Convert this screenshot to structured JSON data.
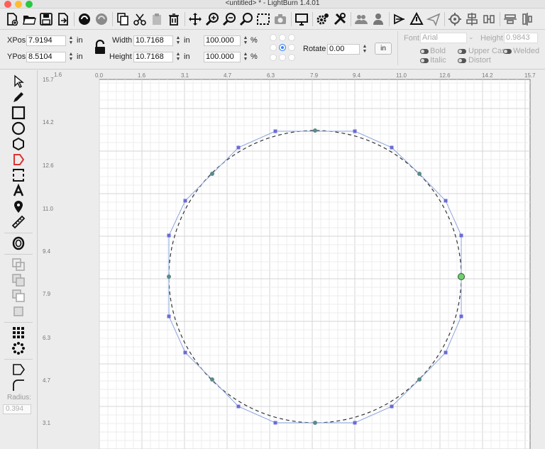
{
  "window": {
    "title": "<untitled> * - LightBurn 1.4.01"
  },
  "props": {
    "xpos_label": "XPos",
    "xpos_value": "7.9194",
    "ypos_label": "YPos",
    "ypos_value": "8.5104",
    "unit": "in",
    "width_label": "Width",
    "width_value": "10.7168",
    "height_label": "Height",
    "height_value": "10.7168",
    "scale_w": "100.000",
    "scale_h": "100.000",
    "percent": "%",
    "rotate_label": "Rotate",
    "rotate_value": "0.00",
    "in_button": "in",
    "font_label": "Font",
    "font_value": "Arial",
    "text_height_label": "Height",
    "text_height_value": "0.9843",
    "bold": "Bold",
    "italic": "Italic",
    "upper_case": "Upper Case",
    "distort": "Distort",
    "welded": "Welded"
  },
  "leftpanel": {
    "radius_label": "Radius:",
    "radius_value": "0.394"
  },
  "ruler": {
    "x_labels": [
      "0.0",
      "1.6",
      "3.1",
      "4.7",
      "6.3",
      "7.9",
      "9.4",
      "11.0",
      "12.6",
      "14.2",
      "15.7"
    ],
    "y_labels": [
      "15.7",
      "14.2",
      "12.6",
      "11.0",
      "9.4",
      "7.9",
      "6.3",
      "4.7",
      "3.1"
    ],
    "corner": "1.6"
  },
  "colors": {
    "accent": "#3b82f6",
    "node": "#6b6bd6",
    "circle": "#333333",
    "poly": "#8aa3e0"
  },
  "icons": {
    "toolbar": [
      "new-file-icon",
      "open-folder-icon",
      "save-icon",
      "export-icon",
      "circle-black-icon",
      "circle-grey-icon",
      "copy-icon",
      "cut-icon",
      "paste-icon",
      "delete-icon",
      "move-icon",
      "zoom-in-icon",
      "zoom-out-icon",
      "zoom-fit-icon",
      "zoom-selection-icon",
      "camera-icon",
      "monitor-icon",
      "settings-icon",
      "tools-icon",
      "group-icon",
      "user-icon",
      "mirror-icon",
      "lightburn-icon",
      "send-icon",
      "target-icon",
      "align-icon",
      "distribute-icon",
      "align-h-icon",
      "align-v-icon"
    ],
    "left": [
      "select-icon",
      "pencil-icon",
      "rectangle-icon",
      "ellipse-icon",
      "polygon-icon",
      "polygon-red-icon",
      "frame-icon",
      "text-icon",
      "position-icon",
      "measure-icon",
      "offset-icon",
      "weld-icon",
      "union-icon",
      "subtract-icon",
      "intersect-icon",
      "array-icon",
      "circular-array-icon",
      "edit-nodes-icon",
      "corner-radius-icon"
    ]
  }
}
